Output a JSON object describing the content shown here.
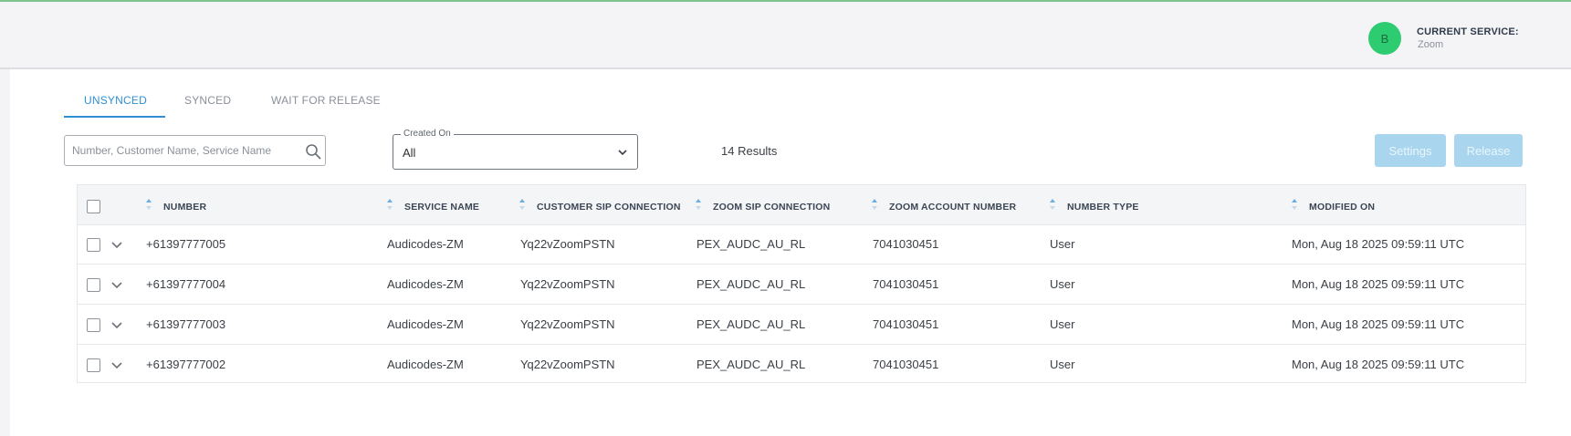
{
  "header": {
    "avatar_initial": "B",
    "service_label": "CURRENT SERVICE:",
    "service_value": "Zoom"
  },
  "tabs": [
    {
      "label": "UNSYNCED",
      "active": true
    },
    {
      "label": "SYNCED",
      "active": false
    },
    {
      "label": "WAIT FOR RELEASE",
      "active": false
    }
  ],
  "filters": {
    "search_placeholder": "Number, Customer Name, Service Name",
    "created_on_label": "Created On",
    "created_on_value": "All",
    "results_text": "14 Results"
  },
  "actions": {
    "settings_label": "Settings",
    "release_label": "Release"
  },
  "table": {
    "columns": [
      "NUMBER",
      "SERVICE NAME",
      "CUSTOMER SIP CONNECTION",
      "ZOOM SIP CONNECTION",
      "ZOOM ACCOUNT NUMBER",
      "NUMBER TYPE",
      "MODIFIED ON"
    ],
    "rows": [
      [
        "+61397777005",
        "Audicodes-ZM",
        "Yq22vZoomPSTN",
        "PEX_AUDC_AU_RL",
        "7041030451",
        "User",
        "Mon, Aug 18 2025 09:59:11 UTC"
      ],
      [
        "+61397777004",
        "Audicodes-ZM",
        "Yq22vZoomPSTN",
        "PEX_AUDC_AU_RL",
        "7041030451",
        "User",
        "Mon, Aug 18 2025 09:59:11 UTC"
      ],
      [
        "+61397777003",
        "Audicodes-ZM",
        "Yq22vZoomPSTN",
        "PEX_AUDC_AU_RL",
        "7041030451",
        "User",
        "Mon, Aug 18 2025 09:59:11 UTC"
      ],
      [
        "+61397777002",
        "Audicodes-ZM",
        "Yq22vZoomPSTN",
        "PEX_AUDC_AU_RL",
        "7041030451",
        "User",
        "Mon, Aug 18 2025 09:59:11 UTC"
      ]
    ]
  },
  "colors": {
    "accent": "#2e8fd1",
    "avatar_bg": "#2ecc71",
    "button_disabled": "#a9d6ee",
    "sort_arrow": "#6aaee0"
  },
  "icons": {
    "search": "search-icon",
    "dropdown": "chevron-down-icon",
    "expand": "chevron-down-icon",
    "sort": "sort-icon"
  }
}
